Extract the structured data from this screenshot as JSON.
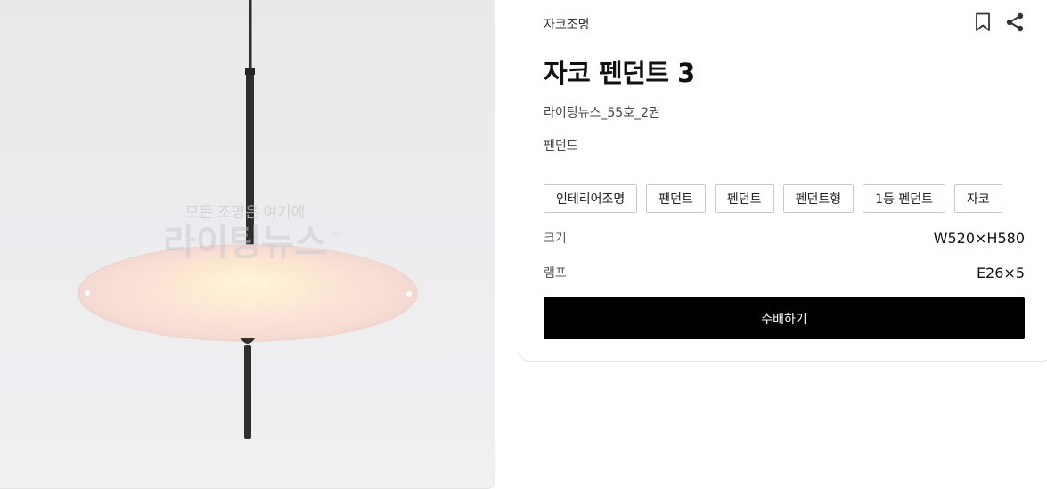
{
  "product": {
    "brand": "자코조명",
    "title": "자코 펜던트 3",
    "source": "라이팅뉴스_55호_2권",
    "category": "펜던트",
    "tags": [
      "인테리어조명",
      "팬던트",
      "펜던트",
      "펜던트형",
      "1등 펜던트",
      "자코"
    ],
    "specs": {
      "size_label": "크기",
      "size_value": "W520×H580",
      "lamp_label": "램프",
      "lamp_value": "E26×5"
    },
    "order_label": "수배하기"
  },
  "image": {
    "watermark_top": "모든 조명은 여기에",
    "watermark_main": "라이팅뉴스"
  },
  "icons": {
    "bookmark": "bookmark-icon",
    "share": "share-icon"
  },
  "colors": {
    "button_bg": "#000000",
    "button_text": "#ffffff",
    "tag_border": "#c9c9c9",
    "lamp_glow": "#fbe7dc"
  }
}
